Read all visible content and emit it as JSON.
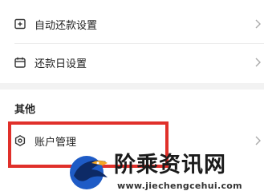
{
  "settings": {
    "auto_repay": {
      "label": "自动还款设置",
      "icon": "calendar-plus-icon"
    },
    "repay_day": {
      "label": "还款日设置",
      "icon": "calendar-icon"
    }
  },
  "other_section": {
    "title": "其他",
    "account_manage": {
      "label": "账户管理",
      "icon": "hexagon-gear-icon"
    }
  },
  "watermark": {
    "name": "阶乘资讯网",
    "url": "www.jiechengcehui.com",
    "logo": "eagle-logo"
  },
  "colors": {
    "highlight": "#e0302a",
    "logo_blue": "#1e5bc6"
  }
}
